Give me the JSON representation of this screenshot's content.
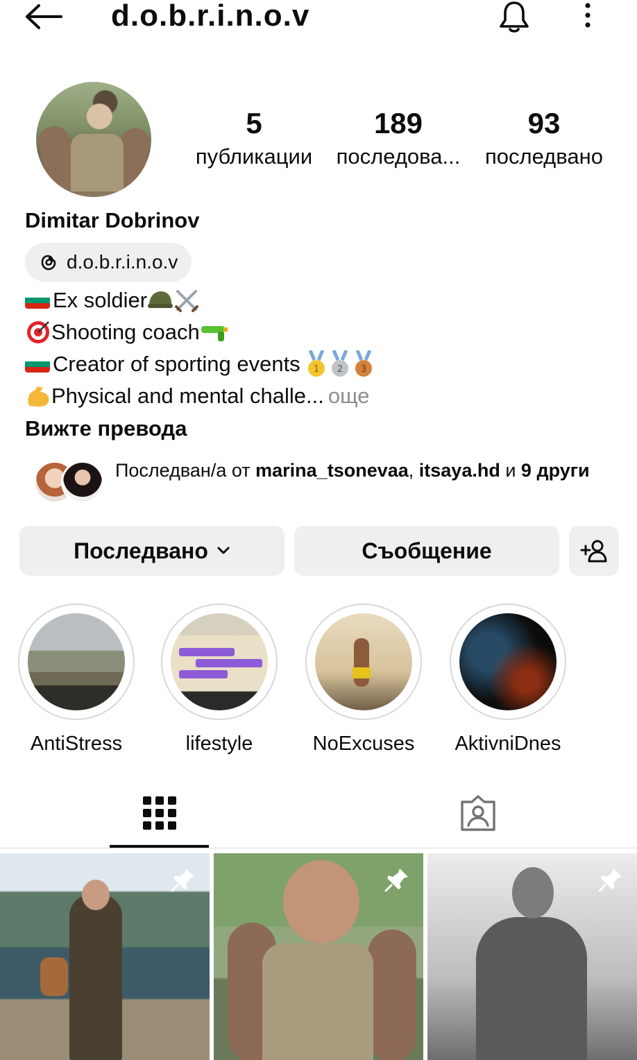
{
  "header": {
    "username": "d.o.b.r.i.n.o.v",
    "icons": [
      "back-arrow-icon",
      "bell-icon",
      "more-vertical-icon"
    ]
  },
  "profile": {
    "full_name": "Dimitar Dobrinov",
    "stats": {
      "posts": {
        "count": "5",
        "label": "публикации"
      },
      "followers": {
        "count": "189",
        "label": "последова..."
      },
      "following": {
        "count": "93",
        "label": "последвано"
      }
    },
    "threads_handle": "d.o.b.r.i.n.o.v",
    "bio": {
      "line1": "Ex soldier",
      "line2": "Shooting coach",
      "line3": "Creator of sporting events",
      "line4": "Physical and mental challe...",
      "more": "още"
    },
    "see_translation": "Вижте превода"
  },
  "followed_by": {
    "prefix": "Последван/а от ",
    "user1": "marina_tsonevaa",
    "separator": ", ",
    "user2": "itsaya.hd",
    "connector": " и ",
    "others": "9 други"
  },
  "actions": {
    "following_label": "Последвано",
    "message_label": "Съобщение"
  },
  "highlights": [
    {
      "label": "AntiStress"
    },
    {
      "label": "lifestyle"
    },
    {
      "label": "NoExcuses"
    },
    {
      "label": "AktivniDnes"
    }
  ],
  "tabs": [
    {
      "name": "grid",
      "icon": "grid-icon",
      "active": true
    },
    {
      "name": "tagged",
      "icon": "tagged-icon",
      "active": false
    }
  ],
  "posts_pinned": [
    true,
    true,
    true
  ],
  "colors": {
    "button_bg": "#efefef",
    "text": "#0c0c0c",
    "muted": "#8e8e8e"
  }
}
